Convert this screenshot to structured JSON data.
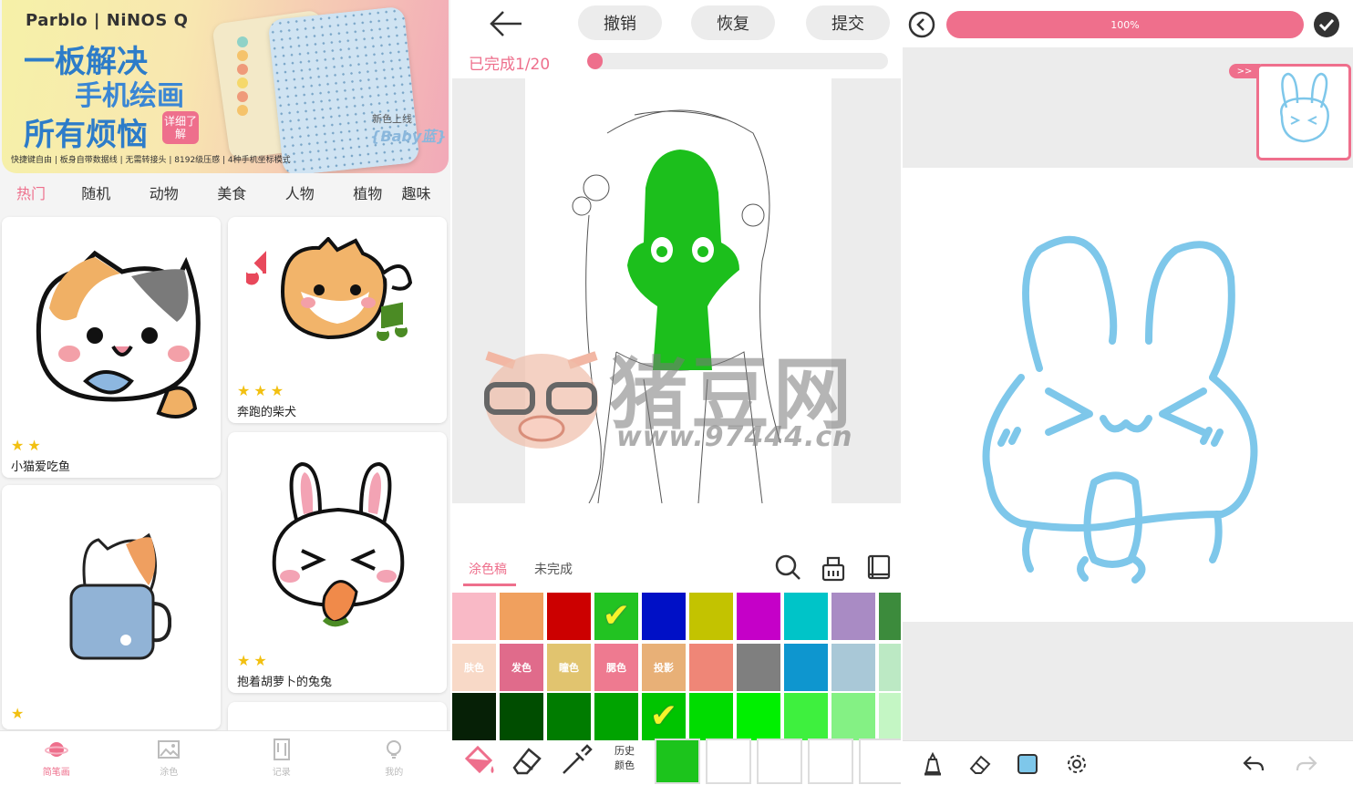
{
  "panel1": {
    "banner": {
      "brand": "Parblo | NiNOS Q",
      "line1": "一板解决",
      "line2": "手机绘画",
      "line3": "所有烦恼",
      "detail": "详细了解",
      "new_color": "新色上线",
      "baby": "{Baby蓝}",
      "features": "快捷键自由 | 板身自带数据线 | 无需转接头 | 8192级压感 | 4种手机坐标模式"
    },
    "categories": [
      "热门",
      "随机",
      "动物",
      "美食",
      "人物",
      "植物",
      "趣味"
    ],
    "cards": [
      {
        "title": "小猫爱吃鱼",
        "stars": "★★"
      },
      {
        "title": "奔跑的柴犬",
        "stars": "★★★"
      },
      {
        "title": "",
        "stars": "★"
      },
      {
        "title": "抱着胡萝卜的兔兔",
        "stars": "★★"
      }
    ],
    "tabs": [
      "简笔画",
      "涂色",
      "记录",
      "我的"
    ]
  },
  "panel2": {
    "undo": "撤销",
    "redo": "恢复",
    "submit": "提交",
    "progress_text": "已完成1/20",
    "progress_fraction": 0.05,
    "watermark_main": "猪豆网",
    "watermark_url": "www.97444.cn",
    "tab_active": "涂色稿",
    "tab_other": "未完成",
    "swatch_labels": [
      "肤色",
      "发色",
      "瞳色",
      "腮色",
      "投影"
    ],
    "history_label_1": "历史",
    "history_label_2": "颜色",
    "colors_row1": [
      "#f9b9c6",
      "#f0a05e",
      "#cc0000",
      "#22c322",
      "#0010c6",
      "#c3c300",
      "#c500c8",
      "#00c4c8",
      "#a98bc4",
      "#3c8b3c"
    ],
    "colors_row2": [
      "#f8d9c7",
      "#e06b8b",
      "#e1c46f",
      "#ee7a90",
      "#e8b077",
      "#ef8677",
      "#7f7f7f",
      "#0e96cf",
      "#a9c8d7",
      "#bce9c4"
    ],
    "colors_row3": [
      "#062006",
      "#004d00",
      "#007c00",
      "#00a300",
      "#00c400",
      "#00dc00",
      "#00f000",
      "#3ef03e",
      "#84f184",
      "#c4f6c4"
    ],
    "history_color": "#1cc41c"
  },
  "panel3": {
    "zoom_label": "100%",
    "thumb_tab": ">>",
    "stroke_color": "#7ec7ea"
  },
  "colors": {
    "accent": "#ee6f8c"
  }
}
